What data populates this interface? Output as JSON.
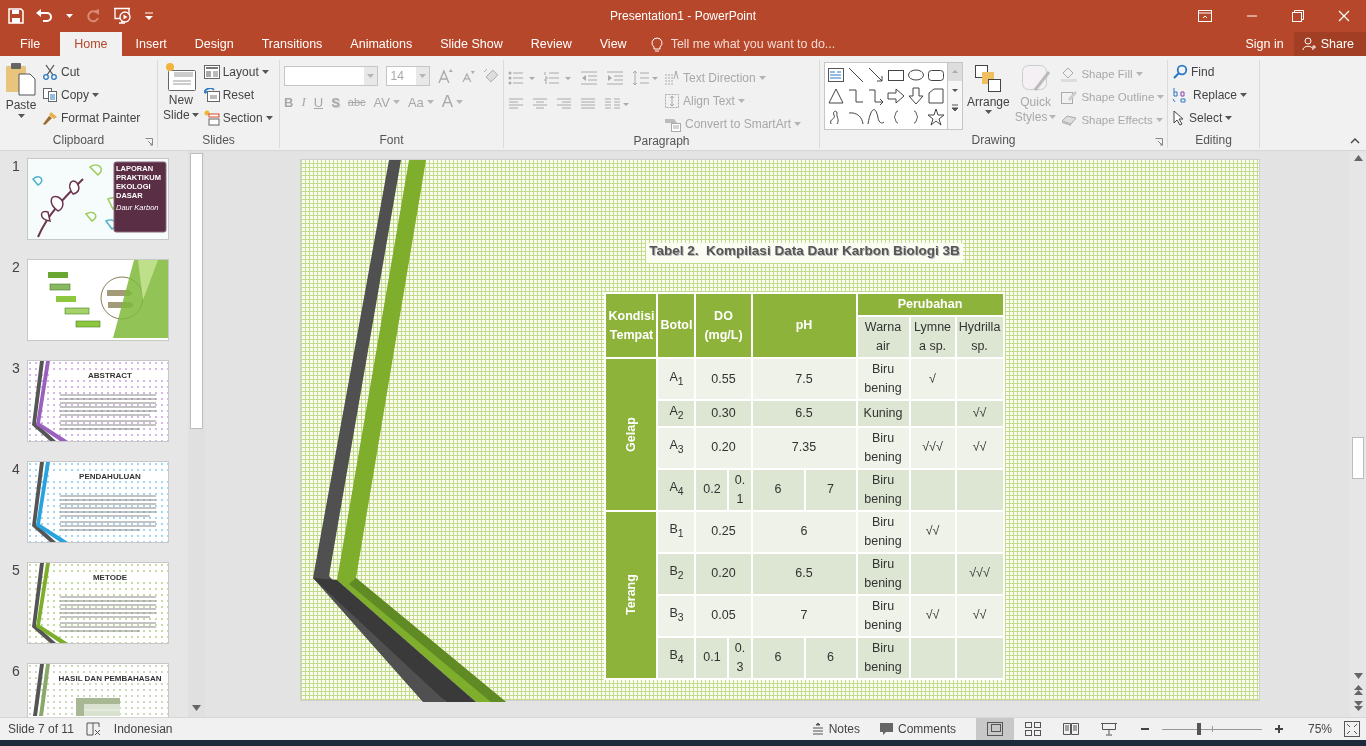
{
  "window": {
    "title": "Presentation1 - PowerPoint"
  },
  "tabs": [
    {
      "label": "File",
      "selected": false
    },
    {
      "label": "Home",
      "selected": true
    },
    {
      "label": "Insert",
      "selected": false
    },
    {
      "label": "Design",
      "selected": false
    },
    {
      "label": "Transitions",
      "selected": false
    },
    {
      "label": "Animations",
      "selected": false
    },
    {
      "label": "Slide Show",
      "selected": false
    },
    {
      "label": "Review",
      "selected": false
    },
    {
      "label": "View",
      "selected": false
    }
  ],
  "tell_me": {
    "placeholder": "Tell me what you want to do..."
  },
  "account": {
    "sign_in": "Sign in",
    "share": "Share"
  },
  "ribbon": {
    "clipboard": {
      "label": "Clipboard",
      "paste": "Paste",
      "commands": [
        {
          "label": "Cut",
          "kind": "cut"
        },
        {
          "label": "Copy",
          "kind": "copy"
        },
        {
          "label": "Format Painter",
          "kind": "painter"
        }
      ]
    },
    "slides": {
      "label": "Slides",
      "new_slide": [
        "New",
        "Slide"
      ],
      "commands": [
        {
          "label": "Layout",
          "kind": "layout"
        },
        {
          "label": "Reset",
          "kind": "reset"
        },
        {
          "label": "Section",
          "kind": "section"
        }
      ]
    },
    "font": {
      "label": "Font",
      "size": "14",
      "disabled": true,
      "buttons": [
        {
          "label": "B",
          "kind": "bold"
        },
        {
          "label": "I",
          "kind": "italic"
        },
        {
          "label": "U",
          "kind": "underline"
        },
        {
          "label": "S",
          "kind": "shadow"
        },
        {
          "label": "abc",
          "kind": "strike"
        },
        {
          "label": "AV",
          "kind": "spacing"
        },
        {
          "label": "Aa",
          "kind": "case"
        },
        {
          "label": "A",
          "kind": "color"
        }
      ]
    },
    "paragraph": {
      "label": "Paragraph",
      "commands": [
        {
          "label": "Text Direction",
          "kind": "direction",
          "disabled": true
        },
        {
          "label": "Align Text",
          "kind": "align",
          "disabled": true
        },
        {
          "label": "Convert to SmartArt",
          "kind": "smartart",
          "disabled": true
        }
      ]
    },
    "drawing": {
      "label": "Drawing",
      "arrange": "Arrange",
      "quick_styles": {
        "label": [
          "Quick",
          "Styles"
        ],
        "disabled": true
      },
      "commands": [
        {
          "label": "Shape Fill",
          "kind": "fill",
          "disabled": true
        },
        {
          "label": "Shape Outline",
          "kind": "outline",
          "disabled": true
        },
        {
          "label": "Shape Effects",
          "kind": "effects",
          "disabled": true
        }
      ]
    },
    "editing": {
      "label": "Editing",
      "commands": [
        {
          "label": "Find",
          "kind": "find"
        },
        {
          "label": "Replace",
          "kind": "replace"
        },
        {
          "label": "Select",
          "kind": "select"
        }
      ]
    }
  },
  "thumbnails": [
    {
      "number": "1",
      "kind": "title",
      "title": "LAPORAN PRAKTIKUM EKOLOGI DASAR",
      "subtitle": "Daur Karbon"
    },
    {
      "number": "2",
      "kind": "diagram"
    },
    {
      "number": "3",
      "kind": "text",
      "title": "ABSTRACT",
      "color": "#9b5fc0"
    },
    {
      "number": "4",
      "kind": "text",
      "title": "PENDAHULUAN",
      "color": "#29a3e0"
    },
    {
      "number": "5",
      "kind": "text",
      "title": "METODE",
      "color": "#7cae2a"
    },
    {
      "number": "6",
      "kind": "table",
      "title": "HASIL DAN PEMBAHASAN",
      "color": "#8aa86a"
    }
  ],
  "slide": {
    "title": "Tabel 2.  Kompilasi Data Daur Karbon Biologi 3B",
    "table": {
      "headers": {
        "kondisi": "Kondisi Tempat",
        "botol": "Botol",
        "do": "DO (mg/L)",
        "ph": "pH",
        "perubahan": "Perubahan",
        "sub": [
          "Warna air",
          "Lymnea sp.",
          "Hydrilla sp."
        ]
      },
      "groups": [
        {
          "label": "Gelap",
          "rows": [
            {
              "botol": "A$_{1}$",
              "do": [
                "0.55"
              ],
              "ph": [
                "7.5"
              ],
              "warna_air": "Biru bening",
              "lymnea": "√"
            },
            {
              "botol": "A$_{2}$",
              "do": [
                "0.30"
              ],
              "ph": [
                "6.5"
              ],
              "warna_air": "Kuning",
              "hydrilla": "√√"
            },
            {
              "botol": "A$_{3}$",
              "do": [
                "0.20"
              ],
              "ph": [
                "7.35"
              ],
              "warna_air": "Biru bening",
              "lymnea": "√√√",
              "hydrilla": "√√"
            },
            {
              "botol": "A$_{4}$",
              "do": [
                "0.2",
                "0.1"
              ],
              "ph": [
                "6",
                "7"
              ],
              "warna_air": "Biru bening"
            }
          ]
        },
        {
          "label": "Terang",
          "rows": [
            {
              "botol": "B$_{1}$",
              "do": [
                "0.25"
              ],
              "ph": [
                "6"
              ],
              "warna_air": "Biru bening",
              "lymnea": "√√"
            },
            {
              "botol": "B$_{2}$",
              "do": [
                "0.20"
              ],
              "ph": [
                "6.5"
              ],
              "warna_air": "Biru bening",
              "hydrilla": "√√√"
            },
            {
              "botol": "B$_{3}$",
              "do": [
                "0.05"
              ],
              "ph": [
                "7"
              ],
              "warna_air": "Biru bening",
              "lymnea": "√√",
              "hydrilla": "√√"
            },
            {
              "botol": "B$_{4}$",
              "do": [
                "0.1",
                "0.3"
              ],
              "ph": [
                "6",
                "6"
              ],
              "warna_air": "Biru bening"
            }
          ]
        }
      ]
    }
  },
  "status_bar": {
    "slide": "Slide 7 of 11",
    "language": "Indonesian",
    "notes": "Notes",
    "comments": "Comments",
    "views": [
      {
        "kind": "normal",
        "selected": true
      },
      {
        "kind": "sorter",
        "selected": false
      },
      {
        "kind": "reading",
        "selected": false
      },
      {
        "kind": "slideshow",
        "selected": false
      }
    ],
    "zoom": {
      "level": 0.37,
      "reading": "75%"
    }
  }
}
